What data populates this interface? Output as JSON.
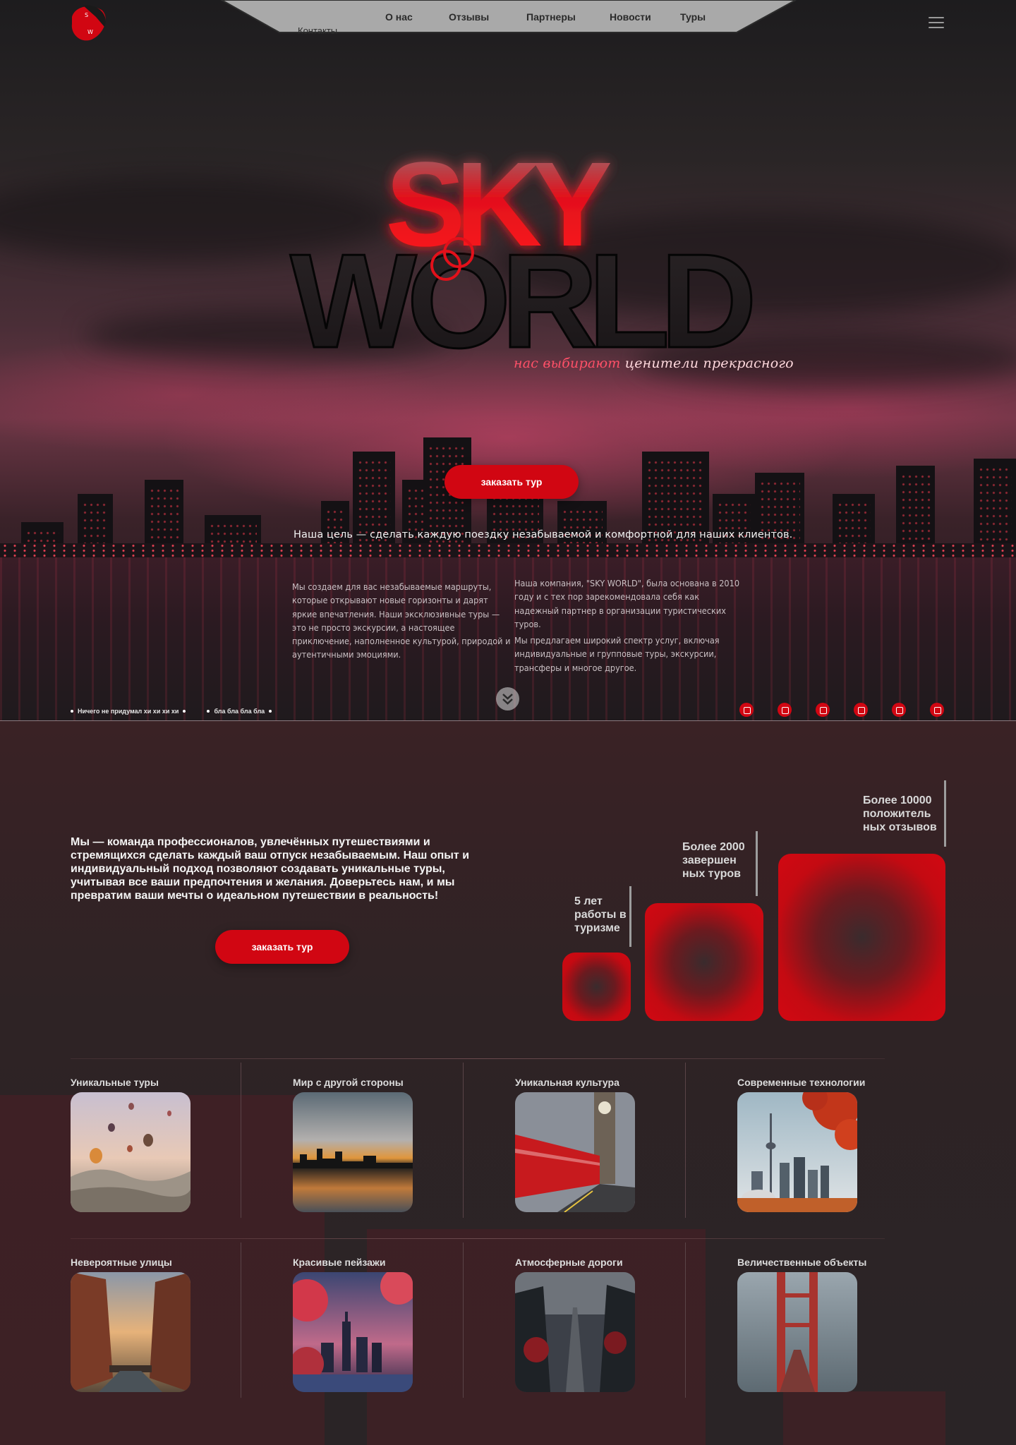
{
  "nav": {
    "items": [
      "О нас",
      "Отзывы",
      "Партнеры",
      "Новости",
      "Туры"
    ],
    "contacts": "Контакты"
  },
  "hero": {
    "brand_top": "SKY",
    "brand_bottom": "WORLD",
    "tagline_red": "нас выбирают",
    "tagline_white": "ценители прекрасного",
    "cta": "заказать тур",
    "mission": "Наша цель — сделать каждую поездку незабываемой и комфортной для наших клиентов.",
    "col_left": "Мы создаем для вас незабываемые маршруты, которые открывают новые горизонты и дарят яркие впечатления. Наши эксклюзивные туры — это не просто экскурсии, а настоящее приключение, наполненное культурой, природой и аутентичными эмоциями.",
    "col_right_1": "Наша компания, \"SKY WORLD\", была основана в 2010 году и с тех пор зарекомендовала себя как надежный партнер в организации туристических туров.",
    "col_right_2": "Мы предлагаем широкий спектр услуг, включая индивидуальные и групповые туры, экскурсии, трансферы и многое другое.",
    "bullet_1": "Ничего не придумал хи хи хи хи",
    "bullet_2": "бла бла бла бла",
    "socials": [
      "youtube-icon",
      "vk-icon",
      "telegram-icon",
      "facebook-icon",
      "tiktok-icon",
      "instagram-icon"
    ]
  },
  "about": {
    "text": "Мы — команда профессионалов, увлечённых путешествиями и стремящихся сделать каждый ваш отпуск незабываемым. Наш опыт и индивидуальный подход позволяют создавать уникальные туры, учитывая все ваши предпочтения и желания. Доверьтесь нам, и мы превратим ваши мечты о идеальном путешествии в реальность!",
    "cta": "заказать тур"
  },
  "stats": [
    {
      "l1": "5 лет",
      "l2": "работы в",
      "l3": "туризме"
    },
    {
      "l1": "Более 2000",
      "l2": "завершен",
      "l3": "ных туров"
    },
    {
      "l1": "Более 10000",
      "l2": "положитель",
      "l3": "ных отзывов"
    }
  ],
  "cards": [
    {
      "title": "Уникальные туры",
      "image": "hot-air-balloons"
    },
    {
      "title": "Мир с другой стороны",
      "image": "sunset-skyline"
    },
    {
      "title": "Уникальная культура",
      "image": "london-bus"
    },
    {
      "title": "Современные технологии",
      "image": "cn-tower"
    },
    {
      "title": "Невероятные улицы",
      "image": "canal-street"
    },
    {
      "title": "Красивые пейзажи",
      "image": "city-cherry-blossom"
    },
    {
      "title": "Атмосферные дороги",
      "image": "forest-road"
    },
    {
      "title": "Величественные объекты",
      "image": "golden-gate-fog"
    }
  ],
  "colors": {
    "accent": "#d10612",
    "background": "#262223"
  }
}
